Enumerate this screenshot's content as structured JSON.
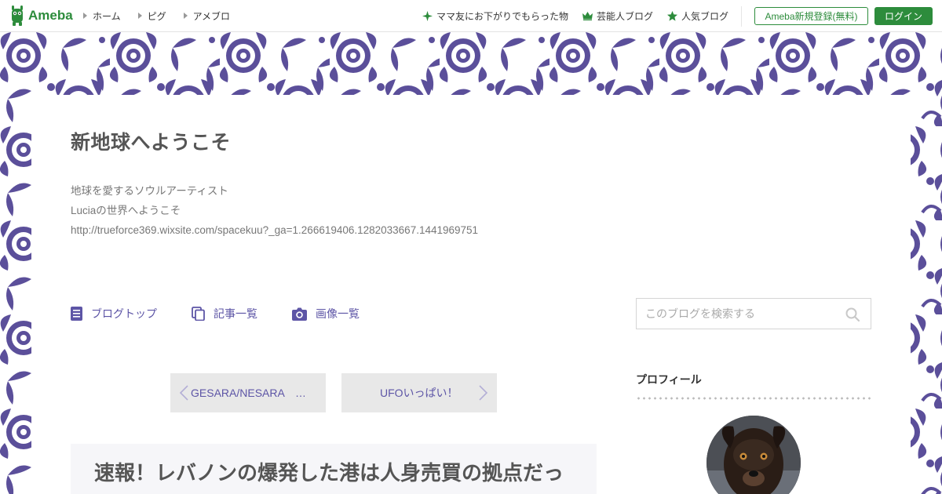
{
  "header": {
    "logo_text": "Ameba",
    "nav": [
      {
        "label": "ホーム"
      },
      {
        "label": "ピグ"
      },
      {
        "label": "アメブロ"
      }
    ],
    "links": [
      {
        "label": "ママ友にお下がりでもらった物",
        "icon": "sparkle-icon"
      },
      {
        "label": "芸能人ブログ",
        "icon": "crown-icon"
      },
      {
        "label": "人気ブログ",
        "icon": "star-icon"
      }
    ],
    "register_label": "Ameba新規登録(無料)",
    "login_label": "ログイン",
    "brand_color": "#2d8c3c"
  },
  "blog": {
    "title": "新地球へようこそ",
    "description": [
      "地球を愛するソウルアーティスト",
      "Luciaの世界へようこそ",
      "http://trueforce369.wixsite.com/spacekuu?_ga=1.266619406.1282033667.1441969751"
    ],
    "nav": [
      {
        "label": "ブログトップ",
        "icon": "document-icon"
      },
      {
        "label": "記事一覧",
        "icon": "copy-icon"
      },
      {
        "label": "画像一覧",
        "icon": "camera-icon"
      }
    ],
    "accent_color": "#5d55a6"
  },
  "search": {
    "placeholder": "このブログを検索する"
  },
  "pager": {
    "prev_label": "GESARA/NESARA　…",
    "next_label": "UFOいっぱい！"
  },
  "article": {
    "title": "速報！レバノンの爆発した港は人身売買の拠点だっ"
  },
  "sidebar": {
    "profile_heading": "プロフィール"
  }
}
